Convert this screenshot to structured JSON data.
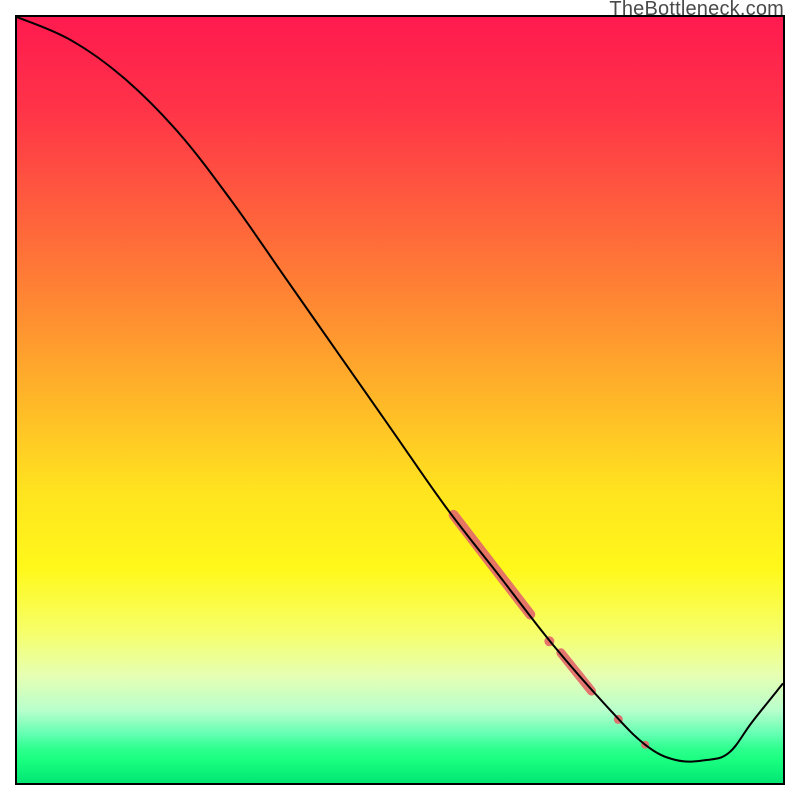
{
  "watermark": "TheBottleneck.com",
  "colors": {
    "border": "#000000",
    "line": "#000000",
    "highlight": "#e46a6a",
    "gradient_stops": [
      {
        "offset": 0.0,
        "color": "#ff1a4f"
      },
      {
        "offset": 0.12,
        "color": "#ff3348"
      },
      {
        "offset": 0.25,
        "color": "#ff5e3d"
      },
      {
        "offset": 0.38,
        "color": "#ff8a32"
      },
      {
        "offset": 0.5,
        "color": "#ffb728"
      },
      {
        "offset": 0.62,
        "color": "#ffe41f"
      },
      {
        "offset": 0.72,
        "color": "#fff81a"
      },
      {
        "offset": 0.8,
        "color": "#f7ff66"
      },
      {
        "offset": 0.86,
        "color": "#e6ffb3"
      },
      {
        "offset": 0.905,
        "color": "#b8ffcc"
      },
      {
        "offset": 0.935,
        "color": "#66ffb3"
      },
      {
        "offset": 0.955,
        "color": "#2eff8f"
      },
      {
        "offset": 0.97,
        "color": "#1aff80"
      },
      {
        "offset": 1.0,
        "color": "#00e673"
      }
    ]
  },
  "chart_data": {
    "type": "line",
    "title": "",
    "xlabel": "",
    "ylabel": "",
    "xlim": [
      0,
      100
    ],
    "ylim": [
      0,
      100
    ],
    "series": [
      {
        "name": "curve",
        "x": [
          0,
          7,
          14,
          21,
          28,
          35,
          42,
          49,
          56,
          63,
          70,
          77,
          82,
          86,
          90,
          93,
          96,
          100
        ],
        "values": [
          100,
          97,
          92,
          85,
          76,
          66,
          56,
          46,
          36,
          27,
          18,
          10,
          5,
          3,
          3,
          4,
          8,
          13
        ]
      }
    ],
    "highlights": [
      {
        "type": "segment",
        "x0": 57,
        "y0": 35,
        "x1": 67,
        "y1": 22,
        "width": 10
      },
      {
        "type": "dot",
        "x": 69.5,
        "y": 18.5,
        "r": 5
      },
      {
        "type": "segment",
        "x0": 71,
        "y0": 17,
        "x1": 75,
        "y1": 12,
        "width": 9
      },
      {
        "type": "dot",
        "x": 78.5,
        "y": 8.3,
        "r": 4.5
      },
      {
        "type": "dot",
        "x": 82,
        "y": 5.0,
        "r": 4
      }
    ]
  }
}
